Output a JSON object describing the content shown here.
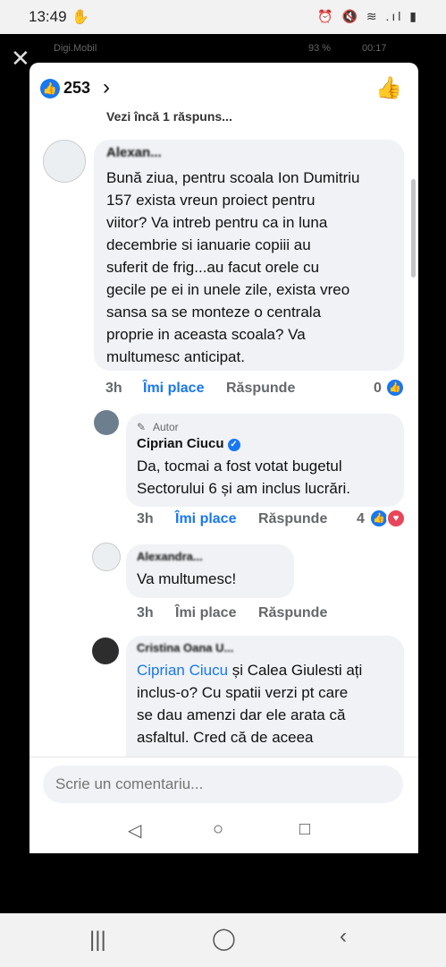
{
  "status_bar": {
    "time": "13:49",
    "icons_text": "⏰ 🔇 ≋ .ıl ▮"
  },
  "inner_status": {
    "carrier": "Digi.Mobil",
    "battery": "93 %",
    "time": "00:17"
  },
  "header": {
    "like_count": "253"
  },
  "more_replies": "Vezi încă 1 răspuns...",
  "comments": [
    {
      "author": "Alexan...",
      "text_lines": [
        "Bună ziua, pentru scoala Ion Dumitriu",
        "157 exista vreun proiect pentru",
        "viitor? Va intreb pentru ca in luna",
        "decembrie si ianuarie copiii au",
        "suferit de frig...au facut orele cu",
        "gecile pe ei in unele zile, exista vreo",
        "sansa sa se monteze o centrala",
        "proprie in aceasta scoala? Va",
        "multumesc anticipat."
      ],
      "time": "3h",
      "like": "Îmi place",
      "reply": "Răspunde",
      "reactions": "0"
    },
    {
      "tag": "Autor",
      "author": "Ciprian Ciucu",
      "text_lines": [
        "Da, tocmai a fost votat bugetul",
        "Sectorului 6 și am inclus lucrări."
      ],
      "time": "3h",
      "like": "Îmi place",
      "reply": "Răspunde",
      "reactions": "4"
    },
    {
      "author": "Alexandra...",
      "text_lines": [
        "Va multumesc!"
      ],
      "time": "3h",
      "like": "Îmi place",
      "reply": "Răspunde"
    },
    {
      "author": "Cristina Oana U...",
      "mention": "Ciprian Ciucu",
      "text_lines": [
        " și Calea Giulesti ați",
        "inclus-o? Cu spatii verzi pt care",
        "se dau amenzi dar ele arata că",
        "asfaltul. Cred că de aceea"
      ]
    }
  ],
  "input": {
    "placeholder": "Scrie un comentariu..."
  },
  "icons": {
    "pencil": "pencil-icon",
    "like": "thumbs-up-icon",
    "verified": "verified-badge-icon"
  },
  "colors": {
    "accent": "#1877f2",
    "love": "#e8455b",
    "bubble": "#f0f2f5"
  }
}
